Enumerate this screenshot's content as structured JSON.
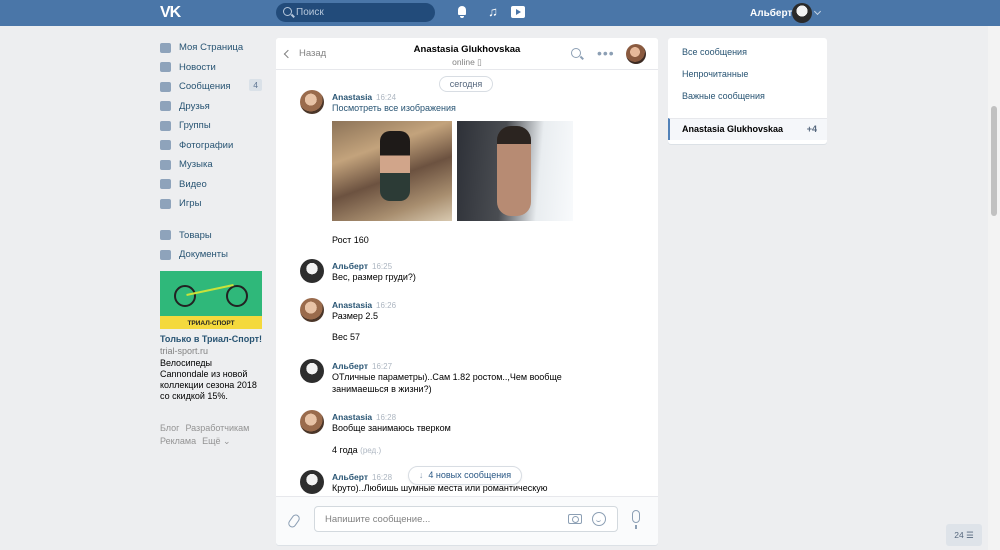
{
  "topbar": {
    "logo": "VK",
    "search_placeholder": "Поиск",
    "user_name": "Альберт"
  },
  "left_nav": {
    "items": [
      {
        "label": "Моя Страница",
        "icon": "home-icon"
      },
      {
        "label": "Новости",
        "icon": "news-icon"
      },
      {
        "label": "Сообщения",
        "icon": "messages-icon",
        "badge": "4"
      },
      {
        "label": "Друзья",
        "icon": "friends-icon"
      },
      {
        "label": "Группы",
        "icon": "groups-icon"
      },
      {
        "label": "Фотографии",
        "icon": "camera-icon"
      },
      {
        "label": "Музыка",
        "icon": "music-icon"
      },
      {
        "label": "Видео",
        "icon": "video-icon"
      },
      {
        "label": "Игры",
        "icon": "games-icon"
      }
    ],
    "items2": [
      {
        "label": "Товары",
        "icon": "goods-icon"
      },
      {
        "label": "Документы",
        "icon": "documents-icon"
      }
    ],
    "ad": {
      "brand": "ТРИАЛ-СПОРТ",
      "title": "Только в Триал-Спорт!",
      "url": "trial-sport.ru",
      "text": "Велосипеды Cannondale из новой коллекции сезона 2018 со скидкой 15%."
    },
    "footer_links": [
      "Блог",
      "Разработчикам",
      "Реклама",
      "Ещё ⌄"
    ]
  },
  "chat": {
    "back_label": "Назад",
    "contact_name": "Anastasia Glukhovskaa",
    "status": "online ▯",
    "date_pill": "сегодня",
    "messages": [
      {
        "author": "Anastasia",
        "time": "16:24",
        "lines": [
          "Посмотреть все изображения",
          "Рост 160"
        ]
      },
      {
        "author": "Альберт",
        "time": "16:25",
        "lines": [
          "Вес, размер груди?)"
        ]
      },
      {
        "author": "Anastasia",
        "time": "16:26",
        "lines": [
          "Размер 2.5",
          "Вес 57"
        ]
      },
      {
        "author": "Альберт",
        "time": "16:27",
        "lines": [
          "ОТличные параметры)..Сам 1.82 ростом..,Чем вообще",
          "занимаешься в жизни?)"
        ]
      },
      {
        "author": "Anastasia",
        "time": "16:28",
        "lines": [
          "Вообще занимаюсь тверком",
          "4 года"
        ],
        "edited": "(ред.)"
      },
      {
        "author": "Альберт",
        "time": "16:28",
        "lines": [
          "Круто)..Любишь шумные места или романтическую"
        ]
      }
    ],
    "new_messages_label": "4 новых сообщения",
    "composer_placeholder": "Напишите сообщение..."
  },
  "right_nav": {
    "items": [
      "Все сообщения",
      "Непрочитанные",
      "Важные сообщения"
    ],
    "active_name": "Anastasia Glukhovskaa",
    "active_count": "+4"
  },
  "corner_badge": "24 ☰",
  "colors": {
    "header_blue": "#4a76a8",
    "link_blue": "#285473",
    "page_bg": "#edeef0"
  }
}
